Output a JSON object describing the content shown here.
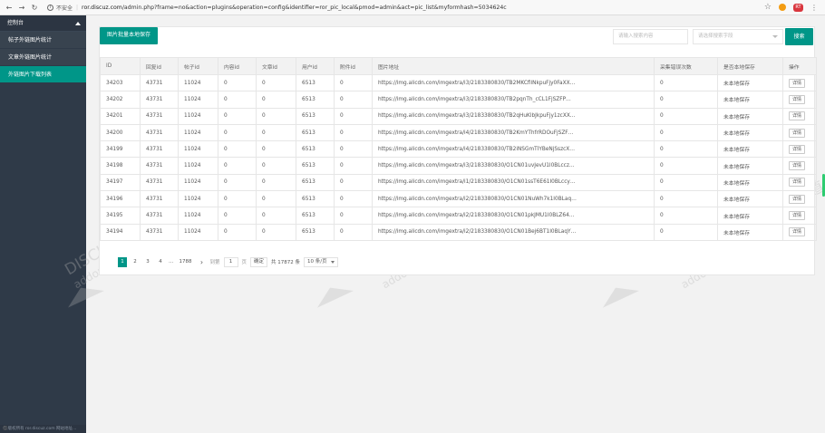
{
  "browser": {
    "secure_label": "不安全",
    "host": "ror.discuz.com",
    "path": "/admin.php?frame=no&action=plugins&operation=config&identifier=ror_pic_local&pmod=admin&act=pic_list&myformhash=5034624c",
    "profile_badge": "RT"
  },
  "sidebar": {
    "header": "控制台",
    "items": [
      {
        "label": "帖子外链图片统计",
        "active": false
      },
      {
        "label": "文章外链图片统计",
        "active": false
      },
      {
        "label": "外链图片下载列表",
        "active": true
      }
    ],
    "footer": "©️版权所有 ror.discuz.com 网站地址..."
  },
  "toolbar": {
    "batch_save_label": "图片批量本地保存",
    "search_placeholder": "请输入搜索内容",
    "field_select_placeholder": "请选择搜索字段",
    "search_button_label": "搜索"
  },
  "table": {
    "columns": [
      "ID",
      "回复id",
      "帖子id",
      "内容id",
      "文章id",
      "用户id",
      "附件id",
      "图片地址",
      "采集错误次数",
      "是否本地保存",
      "操作"
    ],
    "rows": [
      [
        "34203",
        "43731",
        "11024",
        "0",
        "0",
        "6513",
        "0",
        "https://img.alicdn.com/imgextra/i3/2183380830/TB2MKCfllNkpuFjy0FaXX…",
        "0",
        "未本地保存"
      ],
      [
        "34202",
        "43731",
        "11024",
        "0",
        "0",
        "6513",
        "0",
        "https://img.alicdn.com/imgextra/i3/2183380830/TB2pqnTh_cCL1FjSZFP…",
        "0",
        "未本地保存"
      ],
      [
        "34201",
        "43731",
        "11024",
        "0",
        "0",
        "6513",
        "0",
        "https://img.alicdn.com/imgextra/i3/2183380830/TB2qHuKlbJkpuFjy1zcXX…",
        "0",
        "未本地保存"
      ],
      [
        "34200",
        "43731",
        "11024",
        "0",
        "0",
        "6513",
        "0",
        "https://img.alicdn.com/imgextra/i4/2183380830/TB2KmYThfrRDOuFjSZF…",
        "0",
        "未本地保存"
      ],
      [
        "34199",
        "43731",
        "11024",
        "0",
        "0",
        "6513",
        "0",
        "https://img.alicdn.com/imgextra/i4/2183380830/TB2iNSGmTIYBeNjSszcX…",
        "0",
        "未本地保存"
      ],
      [
        "34198",
        "43731",
        "11024",
        "0",
        "0",
        "6513",
        "0",
        "https://img.alicdn.com/imgextra/i3/2183380830/O1CN01uvJevU1I0BLccz…",
        "0",
        "未本地保存"
      ],
      [
        "34197",
        "43731",
        "11024",
        "0",
        "0",
        "6513",
        "0",
        "https://img.alicdn.com/imgextra/i1/2183380830/O1CN01ssT6E61I0BLccy…",
        "0",
        "未本地保存"
      ],
      [
        "34196",
        "43731",
        "11024",
        "0",
        "0",
        "6513",
        "0",
        "https://img.alicdn.com/imgextra/i2/2183380830/O1CN01NuWh7k1I0BLaq…",
        "0",
        "未本地保存"
      ],
      [
        "34195",
        "43731",
        "11024",
        "0",
        "0",
        "6513",
        "0",
        "https://img.alicdn.com/imgextra/i2/2183380830/O1CN01pkJMU1I0BLZ64…",
        "0",
        "未本地保存"
      ],
      [
        "34194",
        "43731",
        "11024",
        "0",
        "0",
        "6513",
        "0",
        "https://img.alicdn.com/imgextra/i2/2183380830/O1CN01Bej6BT1I0BLaqY…",
        "0",
        "未本地保存"
      ]
    ],
    "detail_button_label": "详情"
  },
  "pager": {
    "pages": [
      "1",
      "2",
      "3",
      "4"
    ],
    "ellipsis": "…",
    "last_page": "1788",
    "next": "›",
    "goto_label": "到第",
    "goto_value": "1",
    "page_unit": "页",
    "confirm_label": "确定",
    "total_label": "共 17872 条",
    "per_page_label": "10 条/页"
  },
  "watermark": {
    "line1": "DISCUZ!应用中心 | 试道",
    "line2": "addon.dismall.com"
  }
}
